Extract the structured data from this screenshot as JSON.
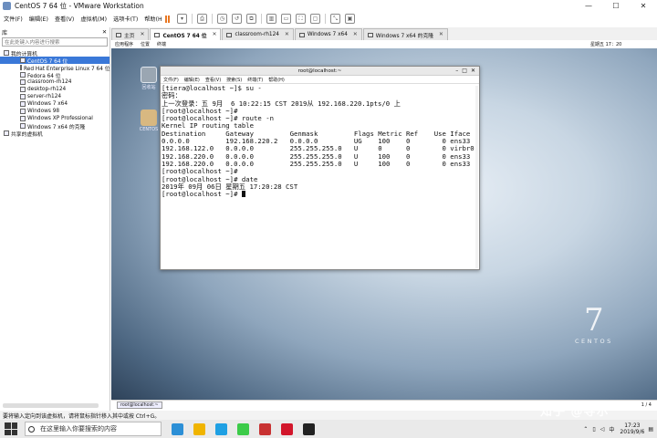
{
  "window": {
    "title": "CentOS 7 64 位 - VMware Workstation",
    "controls": [
      "—",
      "☐",
      "✕"
    ]
  },
  "menubar": {
    "items": [
      "文件(F)",
      "编辑(E)",
      "查看(V)",
      "虚拟机(M)",
      "选项卡(T)",
      "帮助(H)"
    ]
  },
  "library": {
    "title": "库",
    "close": "✕",
    "search_placeholder": "在此处键入内容进行搜索",
    "root": "我的计算机",
    "vms": [
      "CentOS 7 64 位",
      "Red Hat Enterprise Linux 7 64 位",
      "Fedora 64 位",
      "classroom-rh124",
      "desktop-rh124",
      "server-rh124",
      "Windows 7 x64",
      "Windows 98",
      "Windows XP Professional",
      "Windows 7 x64 的克隆"
    ],
    "selected_index": 0,
    "shared": "共享的虚拟机"
  },
  "tabs": [
    {
      "label": "主页",
      "active": false
    },
    {
      "label": "CentOS 7 64 位",
      "active": true
    },
    {
      "label": "classroom-rh124",
      "active": false
    },
    {
      "label": "Windows 7 x64",
      "active": false
    },
    {
      "label": "Windows 7 x64 的克隆",
      "active": false
    }
  ],
  "guest_topbar": {
    "apps": "应用程序",
    "places": "位置",
    "terminal": "终端",
    "clock": "星期五 17：20"
  },
  "desktop": {
    "trash_label": "回收站",
    "folder_label": "CENTOS",
    "logo_number": "7",
    "logo_text": "CENTOS"
  },
  "terminal": {
    "title": "root@localhost:~",
    "menu": [
      "文件(F)",
      "编辑(E)",
      "查看(V)",
      "搜索(S)",
      "终端(T)",
      "帮助(H)"
    ],
    "lines": [
      "[tiera@localhost ~]$ su -",
      "密码：",
      "上一次登录：五 9月  6 10:22:15 CST 2019从 192.168.220.1pts/0 上",
      "[root@localhost ~]#",
      "[root@localhost ~]# route -n",
      "Kernel IP routing table",
      "Destination     Gateway         Genmask         Flags Metric Ref    Use Iface",
      "0.0.0.0         192.168.220.2   0.0.0.0         UG    100    0        0 ens33",
      "192.168.122.0   0.0.0.0         255.255.255.0   U     0      0        0 virbr0",
      "192.168.220.0   0.0.0.0         255.255.255.0   U     100    0        0 ens33",
      "192.168.220.0   0.0.0.0         255.255.255.0   U     100    0        0 ens33",
      "[root@localhost ~]#",
      "[root@localhost ~]# date",
      "2019年 09月 06日 星期五 17:20:28 CST",
      "[root@localhost ~]# "
    ]
  },
  "guest_taskbar": {
    "item": "root@localhost:~",
    "page": "1 / 4"
  },
  "status": "要将输入定向到该虚拟机，请将鼠标指针移入其中或按 Ctrl+G。",
  "host_taskbar": {
    "search_placeholder": "在这里输入你要搜索的内容",
    "time": "17:23",
    "date": "2019/9/6",
    "ime": "中",
    "app_colors": [
      "#2c8fd6",
      "#f0b400",
      "#1fa0e3",
      "#3ccb49",
      "#c83232",
      "#d2162b",
      "#222222"
    ]
  },
  "watermark": "知乎 @导尔"
}
